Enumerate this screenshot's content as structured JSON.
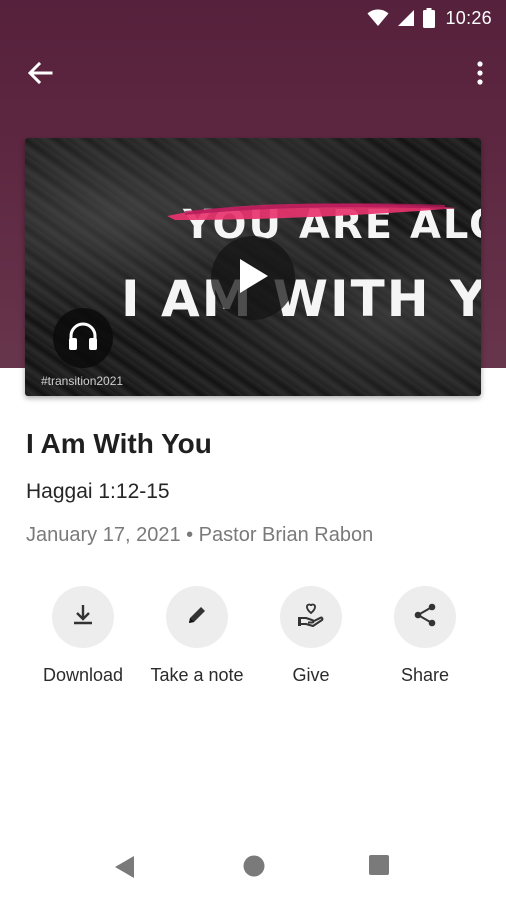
{
  "status_bar": {
    "time": "10:26",
    "icons": [
      "wifi-icon",
      "cell-signal-icon",
      "battery-icon"
    ]
  },
  "toolbar": {
    "back_icon": "arrow-back-icon",
    "more_icon": "more-vert-icon"
  },
  "media": {
    "art_line1": "YOU ARE ALONE.",
    "art_line2": "I AM WITH YOU !!!",
    "hashtag": "#transition2021",
    "play_icon": "play-icon",
    "audio_icon": "headphones-icon"
  },
  "sermon": {
    "title": "I Am With You",
    "scripture": "Haggai 1:12-15",
    "meta": "January 17, 2021 • Pastor Brian Rabon"
  },
  "actions": [
    {
      "label": "Download",
      "icon": "download-icon"
    },
    {
      "label": "Take a note",
      "icon": "pencil-icon"
    },
    {
      "label": "Give",
      "icon": "give-heart-hand-icon"
    },
    {
      "label": "Share",
      "icon": "share-icon"
    }
  ],
  "colors": {
    "header": "#5e2741",
    "accent_stroke": "#e8336f",
    "action_circle": "#ededed"
  },
  "nav_bar": {
    "icons": [
      "nav-back-icon",
      "nav-home-icon",
      "nav-recents-icon"
    ]
  }
}
